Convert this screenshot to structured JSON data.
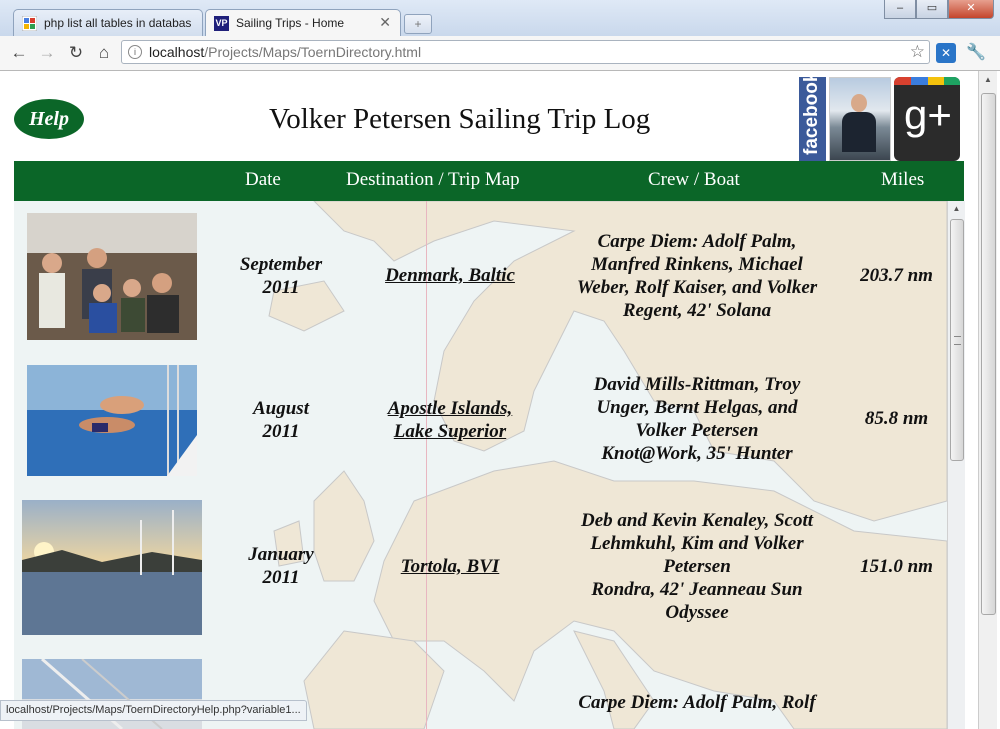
{
  "browser": {
    "tabs": [
      {
        "title": "php list all tables in databas",
        "favicon": "google-icon"
      },
      {
        "title": "Sailing Trips - Home",
        "favicon": "vp-icon",
        "favicon_text": "VP"
      }
    ],
    "url_host": "localhost",
    "url_path": "/Projects/Maps/ToernDirectory.html",
    "status_text": "localhost/Projects/Maps/ToernDirectoryHelp.php?variable1..."
  },
  "header": {
    "help_label": "Help",
    "title": "Volker Petersen Sailing Trip Log",
    "facebook_label": "facebook",
    "gplus_label": "g+"
  },
  "columns": {
    "date": "Date",
    "destination": "Destination / Trip Map",
    "crew": "Crew / Boat",
    "miles": "Miles"
  },
  "trips": [
    {
      "date_line1": "September",
      "date_line2": "2011",
      "destination_line1": "Denmark, Baltic",
      "destination_line2": "",
      "crew_lines": [
        "Carpe Diem: Adolf Palm,",
        "Manfred Rinkens, Michael",
        "Weber, Rolf Kaiser, and Volker",
        "Regent, 42' Solana"
      ],
      "miles": "203.7 nm"
    },
    {
      "date_line1": "August",
      "date_line2": "2011",
      "destination_line1": "Apostle Islands,",
      "destination_line2": "Lake Superior",
      "crew_lines": [
        "David Mills-Rittman, Troy",
        "Unger, Bernt Helgas, and",
        "Volker Petersen",
        "Knot@Work, 35' Hunter"
      ],
      "miles": "85.8 nm"
    },
    {
      "date_line1": "January",
      "date_line2": "2011",
      "destination_line1": "Tortola, BVI",
      "destination_line2": "",
      "crew_lines": [
        "Deb and Kevin Kenaley, Scott",
        "Lehmkuhl, Kim and Volker",
        "Petersen",
        "Rondra, 42' Jeanneau Sun",
        "Odyssee"
      ],
      "miles": "151.0 nm"
    },
    {
      "crew_lines": [
        "Carpe Diem: Adolf Palm, Rolf"
      ]
    }
  ],
  "colors": {
    "brand_green": "#0b6628",
    "facebook_blue": "#3b5a9a"
  }
}
